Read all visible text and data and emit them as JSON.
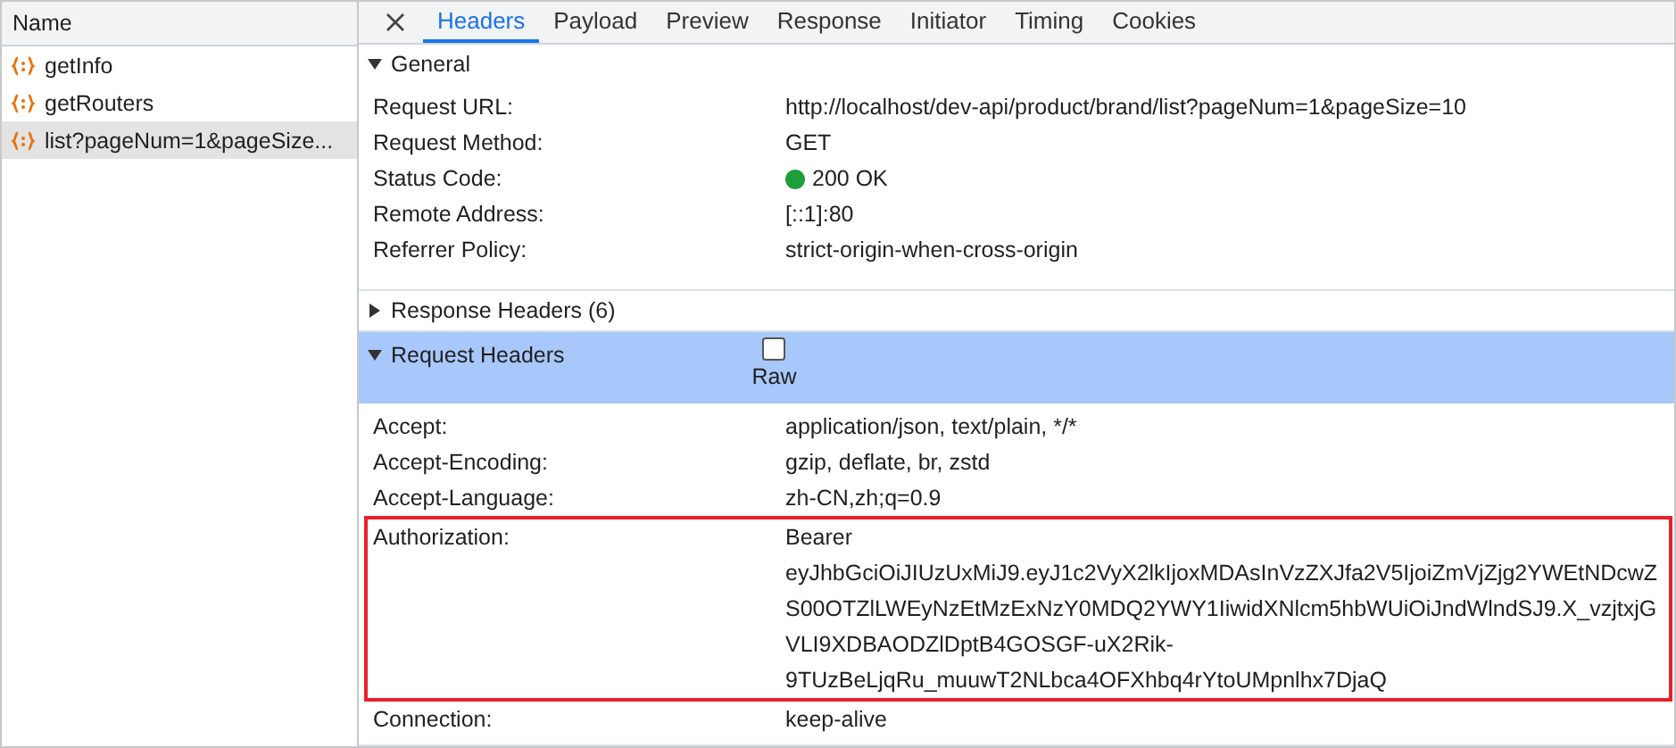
{
  "sidebar": {
    "header": "Name",
    "items": [
      {
        "label": "getInfo",
        "selected": false
      },
      {
        "label": "getRouters",
        "selected": false
      },
      {
        "label": "list?pageNum=1&pageSize...",
        "selected": true
      }
    ]
  },
  "tabs": [
    {
      "label": "Headers",
      "selected": true
    },
    {
      "label": "Payload",
      "selected": false
    },
    {
      "label": "Preview",
      "selected": false
    },
    {
      "label": "Response",
      "selected": false
    },
    {
      "label": "Initiator",
      "selected": false
    },
    {
      "label": "Timing",
      "selected": false
    },
    {
      "label": "Cookies",
      "selected": false
    }
  ],
  "sections": [
    {
      "title": "General",
      "expanded": true,
      "selected": false,
      "rows": [
        {
          "name": "Request URL:",
          "lines": [
            "http://localhost/dev-api/product/brand/list?pageNum=1&pageSize=10"
          ],
          "highlighted": false,
          "kind": "text"
        },
        {
          "name": "Request Method:",
          "lines": [
            "GET"
          ],
          "highlighted": false,
          "kind": "text"
        },
        {
          "name": "Status Code:",
          "lines": [
            "200 OK"
          ],
          "highlighted": false,
          "kind": "status"
        },
        {
          "name": "Remote Address:",
          "lines": [
            "[::1]:80"
          ],
          "highlighted": false,
          "kind": "text"
        },
        {
          "name": "Referrer Policy:",
          "lines": [
            "strict-origin-when-cross-origin"
          ],
          "highlighted": false,
          "kind": "text"
        }
      ]
    },
    {
      "title": "Response Headers (6)",
      "expanded": false,
      "selected": false
    },
    {
      "title": "Request Headers",
      "expanded": true,
      "selected": true,
      "raw": {
        "label": "Raw",
        "checked": false
      },
      "rows": [
        {
          "name": "Accept:",
          "lines": [
            "application/json, text/plain, */*"
          ],
          "highlighted": false,
          "kind": "text"
        },
        {
          "name": "Accept-Encoding:",
          "lines": [
            "gzip, deflate, br, zstd"
          ],
          "highlighted": false,
          "kind": "text"
        },
        {
          "name": "Accept-Language:",
          "lines": [
            "zh-CN,zh;q=0.9"
          ],
          "highlighted": false,
          "kind": "text"
        },
        {
          "name": "Authorization:",
          "lines": [
            "Bearer",
            "eyJhbGciOiJIUzUxMiJ9.eyJ1c2VyX2lkIjoxMDAsInVzZXJfa2V5IjoiZmVjZjg2YWEtNDcwZ",
            "S00OTZlLWEyNzEtMzExNzY0MDQ2YWY1IiwidXNlcm5hbWUiOiJndWlndSJ9.X_vzjtxjG",
            "VLI9XDBAODZlDptB4GOSGF-uX2Rik-",
            "9TUzBeLjqRu_muuwT2NLbca4OFXhbq4rYtoUMpnlhx7DjaQ"
          ],
          "highlighted": true,
          "kind": "text"
        },
        {
          "name": "Connection:",
          "lines": [
            "keep-alive"
          ],
          "highlighted": false,
          "kind": "text"
        }
      ]
    }
  ]
}
